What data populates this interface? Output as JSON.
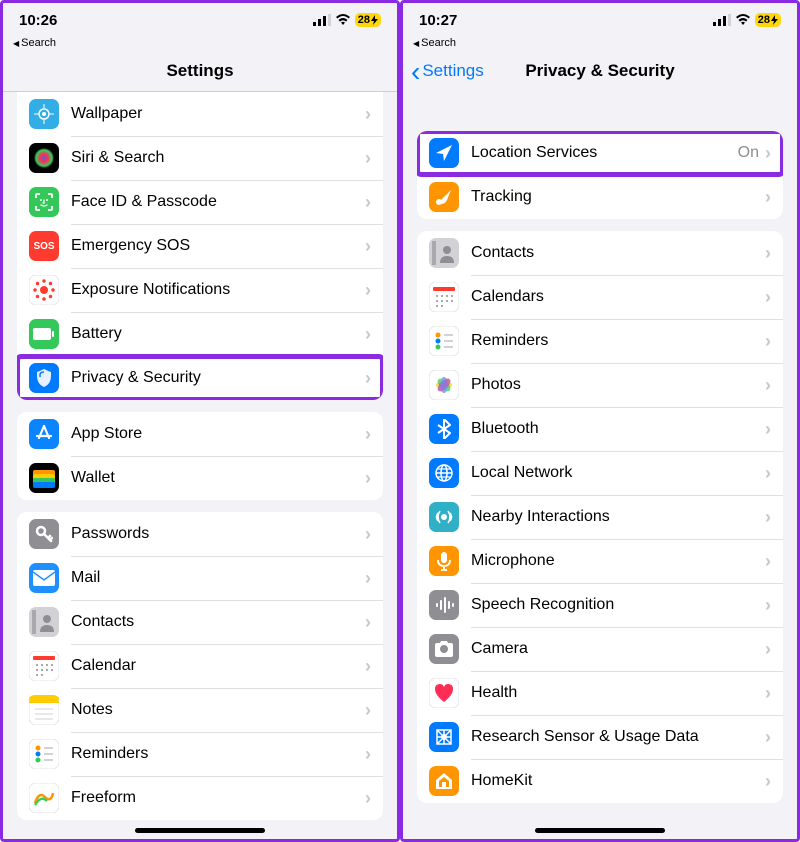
{
  "left": {
    "time": "10:26",
    "battery": "28",
    "back_search": "Search",
    "nav_title": "Settings",
    "groups": [
      [
        {
          "icon": "wallpaper",
          "bg": "#32ade6",
          "label": "Wallpaper"
        },
        {
          "icon": "siri",
          "bg": "#101014",
          "label": "Siri & Search"
        },
        {
          "icon": "faceid",
          "bg": "#34c759",
          "label": "Face ID & Passcode"
        },
        {
          "icon": "sos",
          "bg": "#ff3b30",
          "label": "Emergency SOS",
          "text": "SOS"
        },
        {
          "icon": "exposure",
          "bg": "#ffffff",
          "label": "Exposure Notifications"
        },
        {
          "icon": "battery",
          "bg": "#34c759",
          "label": "Battery"
        },
        {
          "icon": "privacy",
          "bg": "#007aff",
          "label": "Privacy & Security",
          "highlight": true
        }
      ],
      [
        {
          "icon": "appstore",
          "bg": "#0a84ff",
          "label": "App Store"
        },
        {
          "icon": "wallet",
          "bg": "#000000",
          "label": "Wallet"
        }
      ],
      [
        {
          "icon": "passwords",
          "bg": "#8e8e93",
          "label": "Passwords"
        },
        {
          "icon": "mail",
          "bg": "#1e90ff",
          "label": "Mail"
        },
        {
          "icon": "contacts",
          "bg": "#d1d1d6",
          "label": "Contacts"
        },
        {
          "icon": "calendar",
          "bg": "#ffffff",
          "label": "Calendar"
        },
        {
          "icon": "notes",
          "bg": "#ffffff",
          "label": "Notes"
        },
        {
          "icon": "reminders",
          "bg": "#ffffff",
          "label": "Reminders"
        },
        {
          "icon": "freeform",
          "bg": "#ffffff",
          "label": "Freeform"
        }
      ]
    ]
  },
  "right": {
    "time": "10:27",
    "battery": "28",
    "back_search": "Search",
    "nav_back": "Settings",
    "nav_title": "Privacy & Security",
    "groups": [
      [
        {
          "icon": "location",
          "bg": "#007aff",
          "label": "Location Services",
          "value": "On",
          "highlight": true
        },
        {
          "icon": "tracking",
          "bg": "#ff9500",
          "label": "Tracking"
        }
      ],
      [
        {
          "icon": "contacts2",
          "bg": "#d1d1d6",
          "label": "Contacts"
        },
        {
          "icon": "calendars",
          "bg": "#ffffff",
          "label": "Calendars"
        },
        {
          "icon": "reminders2",
          "bg": "#ffffff",
          "label": "Reminders"
        },
        {
          "icon": "photos",
          "bg": "#ffffff",
          "label": "Photos"
        },
        {
          "icon": "bluetooth",
          "bg": "#007aff",
          "label": "Bluetooth"
        },
        {
          "icon": "localnetwork",
          "bg": "#007aff",
          "label": "Local Network"
        },
        {
          "icon": "nearby",
          "bg": "#30b0c7",
          "label": "Nearby Interactions"
        },
        {
          "icon": "microphone",
          "bg": "#ff9500",
          "label": "Microphone"
        },
        {
          "icon": "speech",
          "bg": "#8e8e93",
          "label": "Speech Recognition"
        },
        {
          "icon": "camera",
          "bg": "#8e8e93",
          "label": "Camera"
        },
        {
          "icon": "health",
          "bg": "#ffffff",
          "label": "Health"
        },
        {
          "icon": "research",
          "bg": "#007aff",
          "label": "Research Sensor & Usage Data"
        },
        {
          "icon": "homekit",
          "bg": "#ff9500",
          "label": "HomeKit"
        }
      ]
    ]
  }
}
